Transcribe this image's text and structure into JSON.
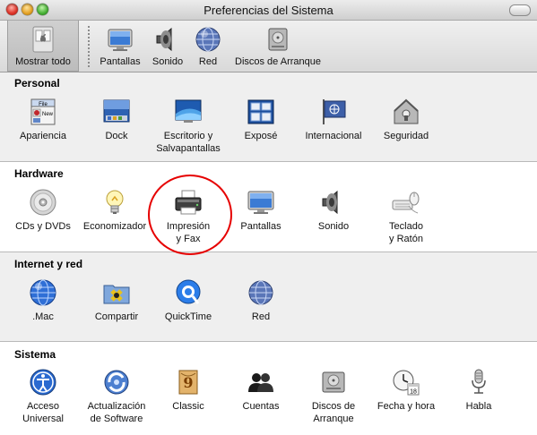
{
  "window": {
    "title": "Preferencias del Sistema"
  },
  "toolbar": {
    "show_all_label": "Mostrar todo",
    "items": [
      {
        "label": "Pantallas",
        "icon": "display-icon"
      },
      {
        "label": "Sonido",
        "icon": "speaker-icon"
      },
      {
        "label": "Red",
        "icon": "network-globe-icon"
      },
      {
        "label": "Discos de Arranque",
        "icon": "startup-disk-icon"
      }
    ]
  },
  "sections": [
    {
      "title": "Personal",
      "panes": [
        {
          "label": "Apariencia",
          "icon": "appearance-icon"
        },
        {
          "label": "Dock",
          "icon": "dock-icon"
        },
        {
          "label": "Escritorio y\nSalvapantallas",
          "icon": "desktop-screensaver-icon"
        },
        {
          "label": "Exposé",
          "icon": "expose-icon"
        },
        {
          "label": "Internacional",
          "icon": "international-flag-icon"
        },
        {
          "label": "Seguridad",
          "icon": "security-house-icon"
        }
      ]
    },
    {
      "title": "Hardware",
      "panes": [
        {
          "label": "CDs y DVDs",
          "icon": "cd-dvd-icon"
        },
        {
          "label": "Economizador",
          "icon": "lightbulb-icon"
        },
        {
          "label": "Impresión\ny Fax",
          "icon": "printer-icon"
        },
        {
          "label": "Pantallas",
          "icon": "display-icon"
        },
        {
          "label": "Sonido",
          "icon": "speaker-icon"
        },
        {
          "label": "Teclado\ny Ratón",
          "icon": "keyboard-mouse-icon"
        }
      ]
    },
    {
      "title": "Internet y red",
      "panes": [
        {
          "label": ".Mac",
          "icon": "dotmac-globe-icon"
        },
        {
          "label": "Compartir",
          "icon": "sharing-folder-icon"
        },
        {
          "label": "QuickTime",
          "icon": "quicktime-icon"
        },
        {
          "label": "Red",
          "icon": "network-globe-icon"
        }
      ]
    },
    {
      "title": "Sistema",
      "panes": [
        {
          "label": "Acceso\nUniversal",
          "icon": "universal-access-icon"
        },
        {
          "label": "Actualización\nde Software",
          "icon": "software-update-icon"
        },
        {
          "label": "Classic",
          "icon": "classic-icon"
        },
        {
          "label": "Cuentas",
          "icon": "accounts-icon"
        },
        {
          "label": "Discos de\nArranque",
          "icon": "startup-disk-icon"
        },
        {
          "label": "Fecha y hora",
          "icon": "date-time-icon"
        },
        {
          "label": "Habla",
          "icon": "speech-microphone-icon"
        }
      ]
    }
  ],
  "annotation": {
    "highlighted_pane": "Impresión\ny Fax",
    "color": "#e60000"
  }
}
